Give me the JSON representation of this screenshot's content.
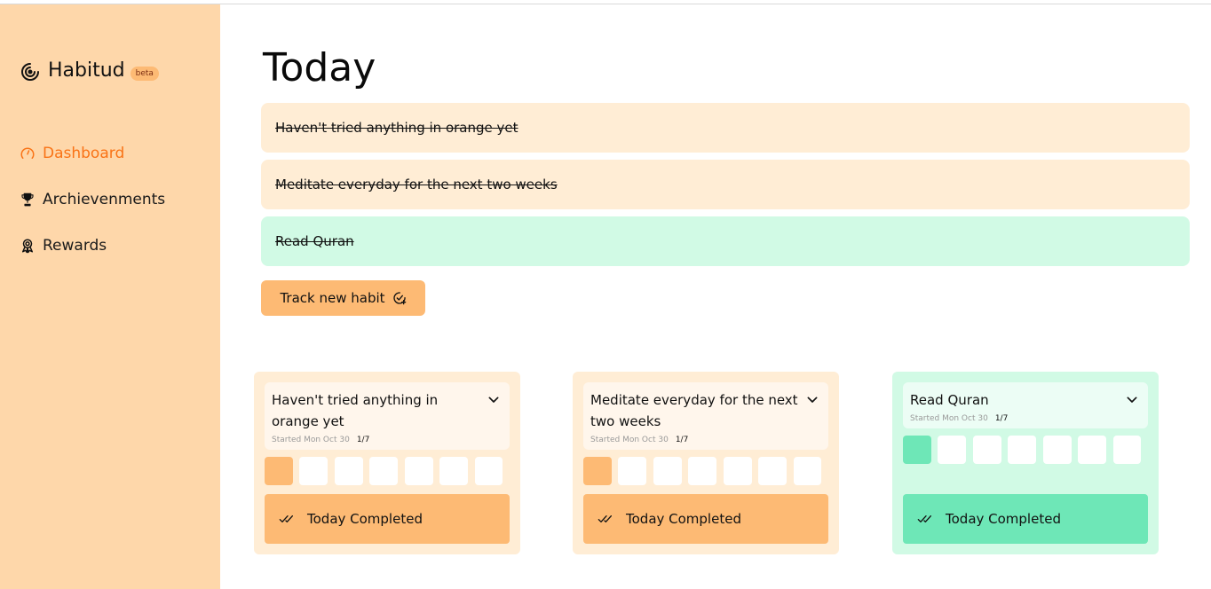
{
  "brand": {
    "name": "Habitud",
    "badge": "beta"
  },
  "nav": [
    {
      "label": "Dashboard",
      "icon": "gauge-icon",
      "active": true
    },
    {
      "label": "Archievenments",
      "icon": "trophy-icon",
      "active": false
    },
    {
      "label": "Rewards",
      "icon": "badge-icon",
      "active": false
    }
  ],
  "page": {
    "title": "Today"
  },
  "today": [
    {
      "text": "Haven't tried anything in orange yet",
      "color": "#ffedd5"
    },
    {
      "text": "Meditate everyday for the next two weeks",
      "color": "#ffedd5"
    },
    {
      "text": "Read Quran",
      "color": "#d1fae5"
    }
  ],
  "track_button": {
    "label": "Track new habit",
    "icon": "calendar-check-plus-icon"
  },
  "cards": [
    {
      "title": "Haven't tried anything in orange yet",
      "started": "Started Mon Oct 30",
      "progress": "1/7",
      "days_done": 1,
      "days_total": 7,
      "complete_label": "Today Completed",
      "theme": "orange"
    },
    {
      "title": "Meditate everyday for the next two weeks",
      "started": "Started Mon Oct 30",
      "progress": "1/7",
      "days_done": 1,
      "days_total": 7,
      "complete_label": "Today Completed",
      "theme": "orange"
    },
    {
      "title": "Read Quran",
      "started": "Started Mon Oct 30",
      "progress": "1/7",
      "days_done": 1,
      "days_total": 7,
      "complete_label": "Today Completed",
      "theme": "green"
    }
  ],
  "colors": {
    "sidebar": "#fed7aa",
    "accent": "#f97316",
    "orange_soft": "#ffedd5",
    "orange": "#fdba74",
    "green_soft": "#d1fae5",
    "green": "#6ee7b7"
  }
}
